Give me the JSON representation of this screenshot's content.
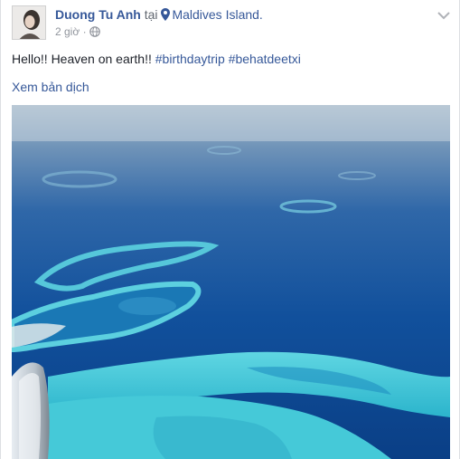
{
  "post": {
    "author": "Duong Tu Anh",
    "location_prefix": "tại",
    "location": "Maldives Island.",
    "time": "2 giờ",
    "separator": "·",
    "privacy_icon": "globe-icon",
    "menu_icon": "chevron-down-icon",
    "message_text": "Hello!! Heaven on earth!!",
    "hashtags": [
      "#birthdaytrip",
      "#behatdeetxi"
    ],
    "see_translation": "Xem bản dịch",
    "photo_icon": "aerial-maldives-photo"
  },
  "colors": {
    "link": "#365899",
    "meta": "#90949c",
    "text": "#1d2129",
    "sea_deep": "#0f4e9a",
    "lagoon": "#36c3d6"
  }
}
